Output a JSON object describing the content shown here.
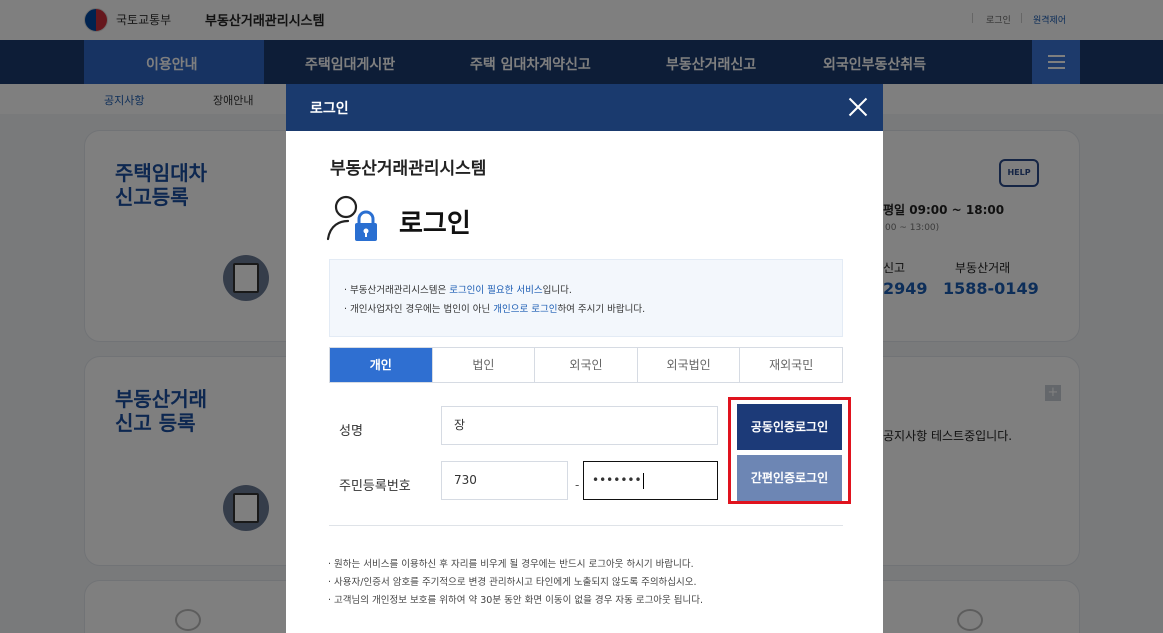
{
  "header": {
    "ministry": "국토교통부",
    "system_name": "부동산거래관리시스템",
    "links": [
      "로그인",
      "원격제어"
    ]
  },
  "gnb": {
    "items": [
      "이용안내",
      "주택임대게시판",
      "주택 임대차계약신고",
      "부동산거래신고",
      "외국인부동산취득"
    ],
    "menu_icon": "hamburger-icon"
  },
  "subnav": {
    "items": [
      "공지사항",
      "장애안내"
    ]
  },
  "background_cards": {
    "card1_title": "주택임대차\n신고등록",
    "card2_title": "부동산거래\n신고 등록",
    "help_label": "HELP",
    "hours": "평일 09:00 ~ 18:00",
    "hours_sub": "00 ~ 13:00)",
    "phone_label_1": "신고",
    "phone_label_2": "부동산거래",
    "phone_1": "2949",
    "phone_2": "1588-0149",
    "notice_text": "공지사항 테스트중입니다.",
    "plus": "+"
  },
  "modal": {
    "title": "로그인",
    "system_title": "부동산거래관리시스템",
    "login_heading": "로그인",
    "notice": {
      "line1_pre": "· 부동산거래관리시스템은 ",
      "line1_hl": "로그인이 필요한 서비스",
      "line1_post": "입니다.",
      "line2_pre": "· 개인사업자인 경우에는 법인이 아닌 ",
      "line2_hl": "개인으로 로그인",
      "line2_post": "하여 주시기 바랍니다."
    },
    "tabs": [
      "개인",
      "법인",
      "외국인",
      "외국법인",
      "재외국민"
    ],
    "active_tab": "개인",
    "name_label": "성명",
    "name_value": "장",
    "rrn_label": "주민등록번호",
    "rrn_front": "730",
    "rrn_dash": "-",
    "rrn_back_masked": "•••••••",
    "btn_cert_login": "공동인증로그인",
    "btn_simple_login": "간편인증로그인",
    "footer": [
      "· 원하는 서비스를 이용하신 후 자리를 비우게 될 경우에는 반드시 로그아웃 하시기 바랍니다.",
      "· 사용자/인증서 암호를 주기적으로 변경 관리하시고 타인에게 노출되지 않도록 주의하십시오.",
      "· 고객님의 개인정보 보호를 위하여 약 30분 동안 화면 이동이 없을 경우 자동 로그아웃 됩니다."
    ]
  },
  "colors": {
    "navy": "#1a3a6e",
    "accent_blue": "#2f6fd1",
    "highlight_red": "#e0131e"
  }
}
